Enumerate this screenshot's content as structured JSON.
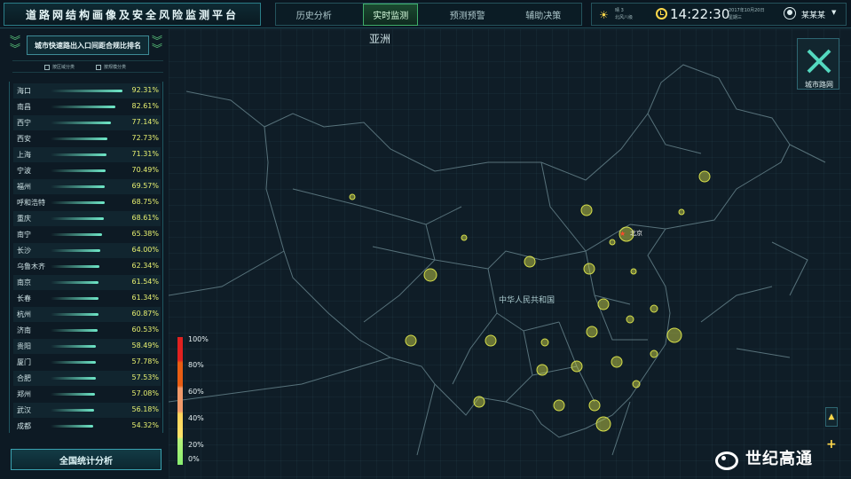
{
  "header": {
    "title": "道路网结构画像及安全风险监测平台",
    "tabs": [
      "历史分析",
      "实时监测",
      "预测预警",
      "辅助决策"
    ],
    "active_tab": 1,
    "weather_lines": [
      "晴 3",
      "北风八级"
    ],
    "time": "14:22:30",
    "date_lines": [
      "2017年10月20日",
      "星期三"
    ],
    "user": "某某某"
  },
  "left_panel": {
    "title": "城市快速路出入口间距合规比排名",
    "filters": [
      "按区域分类",
      "按规模分类"
    ],
    "rankings": [
      {
        "city": "海口",
        "value": "92.31%"
      },
      {
        "city": "南昌",
        "value": "82.61%"
      },
      {
        "city": "西宁",
        "value": "77.14%"
      },
      {
        "city": "西安",
        "value": "72.73%"
      },
      {
        "city": "上海",
        "value": "71.31%"
      },
      {
        "city": "宁波",
        "value": "70.49%"
      },
      {
        "city": "福州",
        "value": "69.57%"
      },
      {
        "city": "呼和浩特",
        "value": "68.75%"
      },
      {
        "city": "重庆",
        "value": "68.61%"
      },
      {
        "city": "南宁",
        "value": "65.38%"
      },
      {
        "city": "长沙",
        "value": "64.00%"
      },
      {
        "city": "乌鲁木齐",
        "value": "62.34%"
      },
      {
        "city": "南京",
        "value": "61.54%"
      },
      {
        "city": "长春",
        "value": "61.34%"
      },
      {
        "city": "杭州",
        "value": "60.87%"
      },
      {
        "city": "济南",
        "value": "60.53%"
      },
      {
        "city": "贵阳",
        "value": "58.49%"
      },
      {
        "city": "厦门",
        "value": "57.78%"
      },
      {
        "city": "合肥",
        "value": "57.53%"
      },
      {
        "city": "郑州",
        "value": "57.08%"
      },
      {
        "city": "武汉",
        "value": "56.18%"
      },
      {
        "city": "成都",
        "value": "54.32%"
      }
    ],
    "stats_button": "全国统计分析"
  },
  "map": {
    "region_title": "亚洲",
    "country_label": "中华人民共和国",
    "capital_label": "北京",
    "road_button_label": "城市路网",
    "legend_levels": [
      "100%",
      "80%",
      "60%",
      "40%",
      "20%",
      "0%"
    ],
    "legend_colors": [
      "#e0211f",
      "#e85d13",
      "#f29a6a",
      "#ffd35a",
      "#ffe36a",
      "#88ee70"
    ],
    "marker_color": "#d8e04a"
  },
  "watermark": "世纪高通"
}
